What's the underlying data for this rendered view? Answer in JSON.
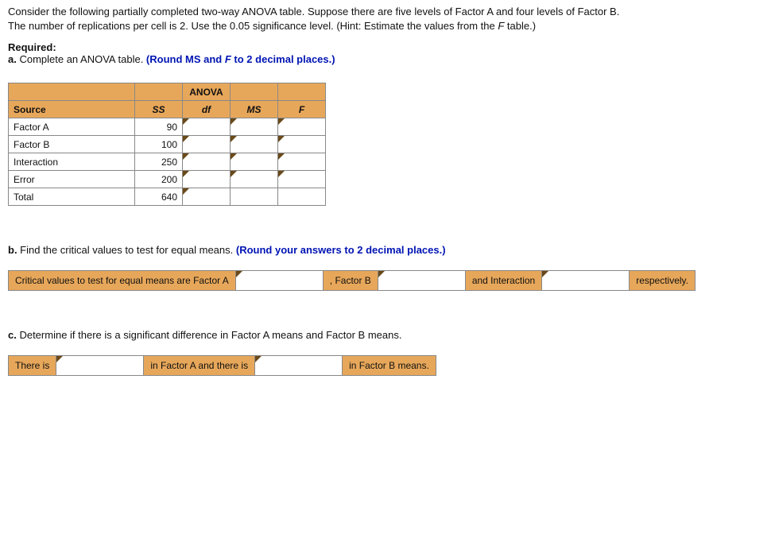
{
  "intro": {
    "line1": "Consider the following partially completed two-way ANOVA table. Suppose there are five levels of Factor A and four levels of Factor B.",
    "line2_pre": "The number of replications per cell is 2. Use the 0.05 significance level. (Hint: Estimate the values from the ",
    "line2_var": "F",
    "line2_post": " table.)"
  },
  "required_label": "Required:",
  "part_a": {
    "label": "a.",
    "text_pre": " Complete an ANOVA table. ",
    "hint_pre": "(Round MS and ",
    "hint_var": "F",
    "hint_post": " to 2 decimal places.)"
  },
  "anova": {
    "title": "ANOVA",
    "cols": {
      "source": "Source",
      "ss": "SS",
      "df": "df",
      "ms": "MS",
      "f": "F"
    },
    "rows": [
      {
        "source": "Factor A",
        "ss": "90"
      },
      {
        "source": "Factor B",
        "ss": "100"
      },
      {
        "source": "Interaction",
        "ss": "250"
      },
      {
        "source": "Error",
        "ss": "200"
      },
      {
        "source": "Total",
        "ss": "640"
      }
    ]
  },
  "part_b": {
    "label": "b.",
    "text": " Find the critical values to test for equal means. ",
    "hint": "(Round your answers to 2 decimal places.)",
    "seg1": "Critical values to test for equal means are Factor A",
    "seg2": ", Factor B",
    "seg3": "and Interaction",
    "seg4": "respectively."
  },
  "part_c": {
    "label": "c.",
    "text": " Determine if there is a significant difference in Factor A means and Factor B means.",
    "seg1": "There is",
    "seg2": "in Factor A and there is",
    "seg3": "in Factor B means."
  }
}
